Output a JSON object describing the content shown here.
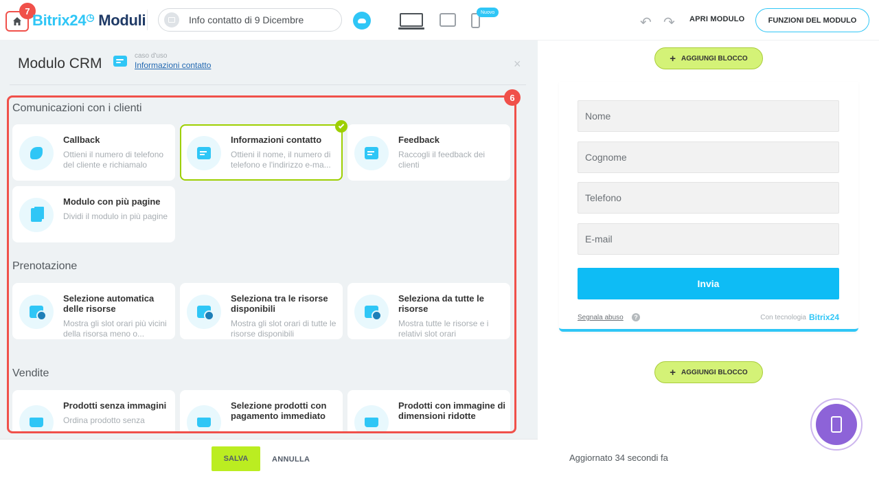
{
  "header": {
    "home_badge": "7",
    "logo_brand": "Bitrix24",
    "logo_clock": "◷",
    "logo_product": "Moduli",
    "page_name": "Info contatto di 9 Dicembre",
    "new_badge": "Nuovo",
    "open_form_label": "APRI MODULO",
    "form_features_label": "FUNZIONI DEL MODULO"
  },
  "panel": {
    "title": "Modulo CRM",
    "usecase_label": "caso d'uso",
    "usecase_link": "Informazioni contatto",
    "close_glyph": "×",
    "templates_badge": "6"
  },
  "sections": [
    {
      "title": "Comunicazioni con i clienti",
      "cards": [
        {
          "title": "Callback",
          "desc": "Ottieni il numero di telefono del cliente e richiamalo",
          "icon": "phone-icon"
        },
        {
          "title": "Informazioni contatto",
          "desc": "Ottieni il nome, il numero di telefono e l'indirizzo e-ma...",
          "icon": "form-icon",
          "selected": true
        },
        {
          "title": "Feedback",
          "desc": "Raccogli il feedback dei clienti",
          "icon": "feedback-icon"
        },
        {
          "title": "Modulo con più pagine",
          "desc": "Dividi il modulo in più pagine",
          "icon": "pages-icon"
        }
      ]
    },
    {
      "title": "Prenotazione",
      "cards": [
        {
          "title": "Selezione automatica delle risorse",
          "desc": "Mostra gli slot orari più vicini della risorsa meno o...",
          "icon": "calendar-icon"
        },
        {
          "title": "Seleziona tra le risorse disponibili",
          "desc": "Mostra gli slot orari di tutte le risorse disponibili",
          "icon": "calendar-icon"
        },
        {
          "title": "Seleziona da tutte le risorse",
          "desc": "Mostra tutte le risorse e i relativi slot orari",
          "icon": "calendar-icon"
        }
      ]
    },
    {
      "title": "Vendite",
      "cards": [
        {
          "title": "Prodotti senza immagini",
          "desc": "Ordina prodotto senza",
          "icon": "cart-icon"
        },
        {
          "title": "Selezione prodotti con pagamento immediato",
          "desc": "",
          "icon": "payment-icon"
        },
        {
          "title": "Prodotti con immagine di dimensioni ridotte",
          "desc": "",
          "icon": "cart-image-icon"
        }
      ]
    }
  ],
  "footer": {
    "save_label": "SALVA",
    "cancel_label": "ANNULLA"
  },
  "preview": {
    "add_block_label": "AGGIUNGI BLOCCO",
    "plus_glyph": "+",
    "fields": [
      "Nome",
      "Cognome",
      "Telefono",
      "E-mail"
    ],
    "submit_label": "Invia",
    "abuse_label": "Segnala abuso",
    "help_glyph": "?",
    "powered_label": "Con tecnologia",
    "powered_brand": "Bitrix24",
    "updated_label": "Aggiornato 34 secondi fa"
  },
  "colors": {
    "accent": "#2fc6f6",
    "highlight": "#f0504a",
    "selected": "#9dcf00",
    "save": "#bbed21"
  }
}
